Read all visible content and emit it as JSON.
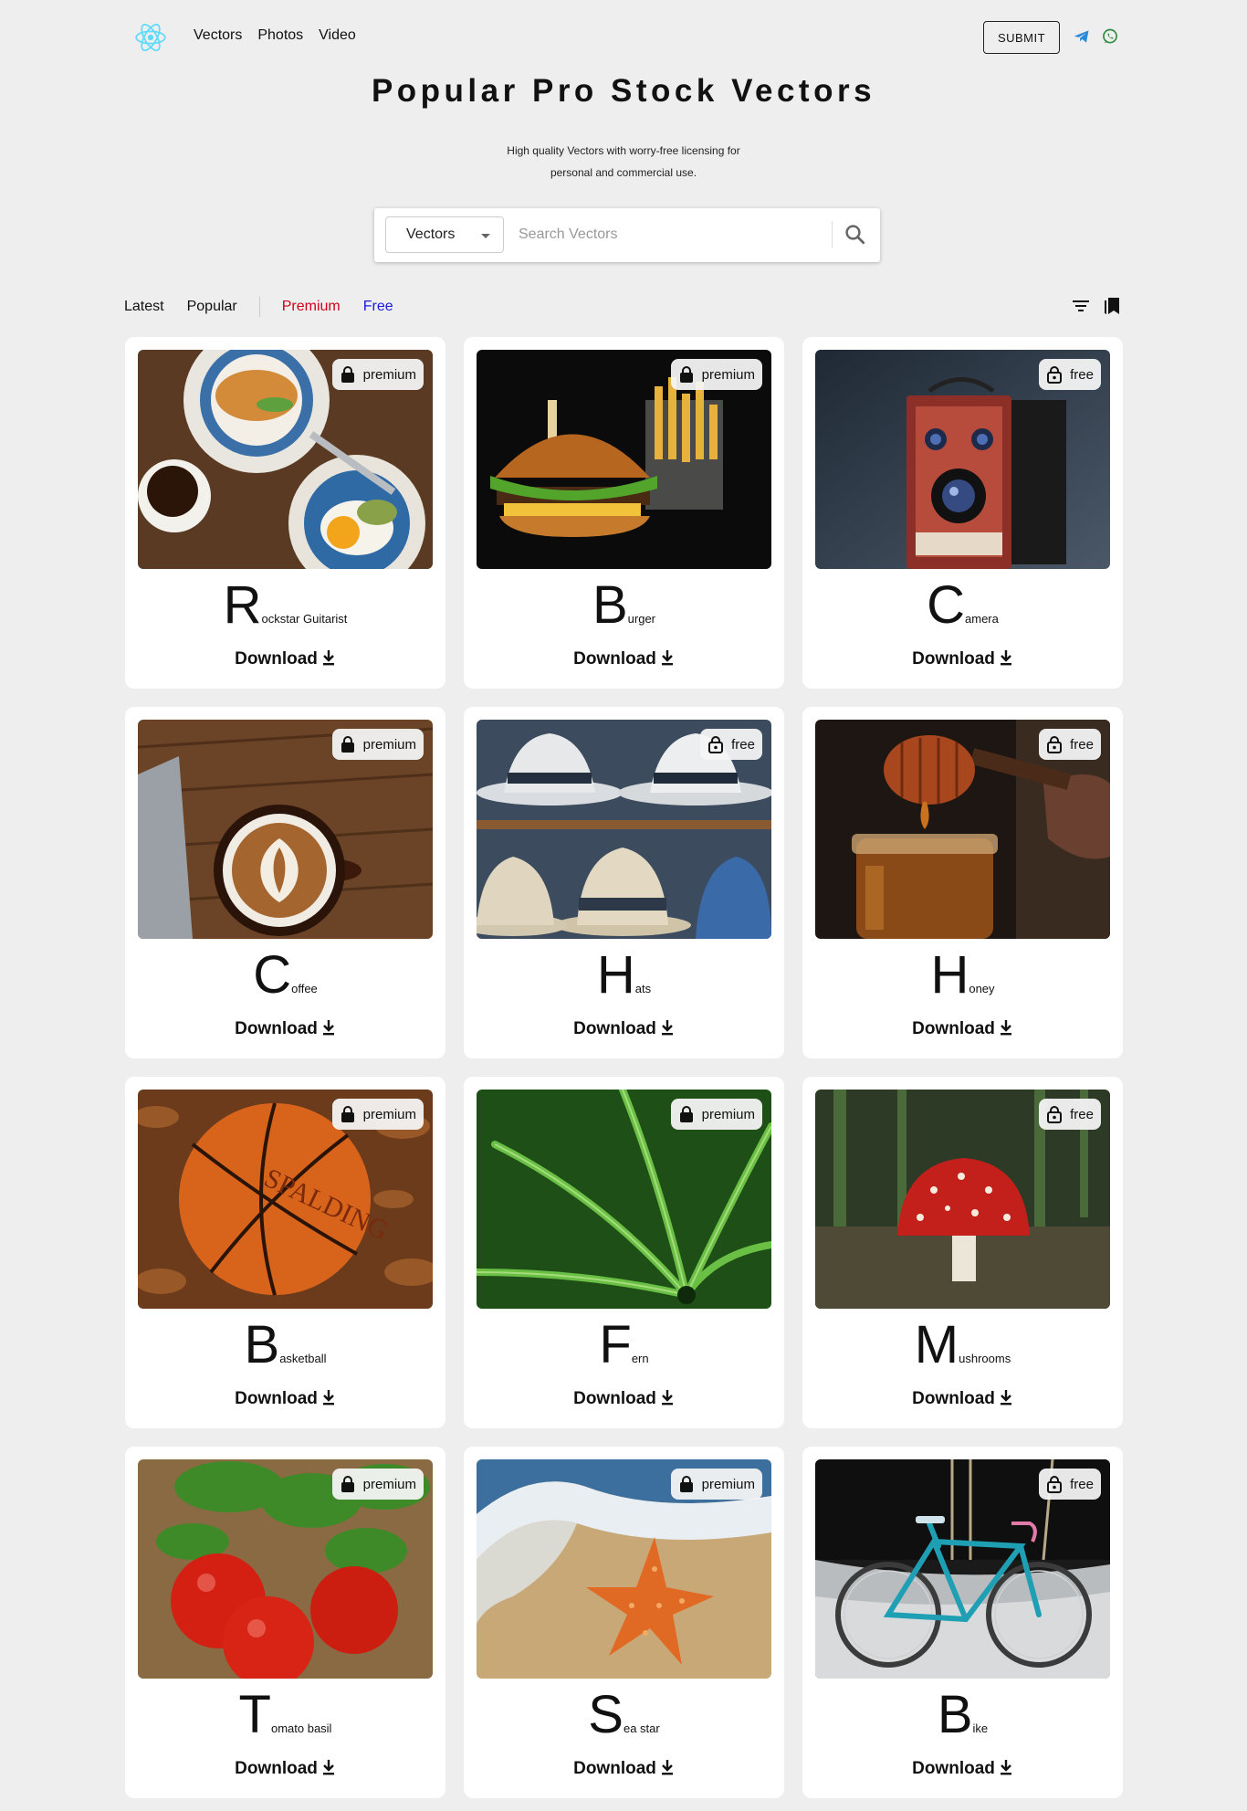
{
  "nav": {
    "links": [
      "Vectors",
      "Photos",
      "Video"
    ],
    "submit_label": "SUBMIT",
    "social": [
      "telegram-icon",
      "whatsapp-icon"
    ]
  },
  "hero": {
    "title": "Popular Pro Stock Vectors",
    "subtitle_line1": "High quality Vectors with worry-free licensing for",
    "subtitle_line2": "personal and commercial use."
  },
  "search": {
    "category_value": "Vectors",
    "placeholder": "Search Vectors"
  },
  "filters": {
    "latest": "Latest",
    "popular": "Popular",
    "premium": "Premium",
    "free": "Free"
  },
  "colors": {
    "premium": "#d0021b",
    "free": "#1a1adb",
    "telegram": "#2a8ad8",
    "whatsapp": "#2e8b3a",
    "logo": "#61dafb"
  },
  "download_label": "Download",
  "cards": [
    {
      "badge": "premium",
      "initial": "R",
      "rest": "ockstar Guitarist",
      "image": "breakfast-table-photo"
    },
    {
      "badge": "premium",
      "initial": "B",
      "rest": "urger",
      "image": "burger-and-fries-photo"
    },
    {
      "badge": "free",
      "initial": "C",
      "rest": "amera",
      "image": "vintage-box-camera-photo"
    },
    {
      "badge": "premium",
      "initial": "C",
      "rest": "offee",
      "image": "latte-art-coffee-photo"
    },
    {
      "badge": "free",
      "initial": "H",
      "rest": "ats",
      "image": "panama-hats-photo"
    },
    {
      "badge": "free",
      "initial": "H",
      "rest": "oney",
      "image": "honey-dipper-jar-photo"
    },
    {
      "badge": "premium",
      "initial": "B",
      "rest": "asketball",
      "image": "basketball-in-leaves-photo"
    },
    {
      "badge": "premium",
      "initial": "F",
      "rest": "ern",
      "image": "fern-leaves-photo"
    },
    {
      "badge": "free",
      "initial": "M",
      "rest": "ushrooms",
      "image": "red-mushroom-photo"
    },
    {
      "badge": "premium",
      "initial": "T",
      "rest": "omato basil",
      "image": "tomato-basil-photo"
    },
    {
      "badge": "premium",
      "initial": "S",
      "rest": "ea star",
      "image": "starfish-beach-photo"
    },
    {
      "badge": "free",
      "initial": "B",
      "rest": "ike",
      "image": "bicycle-photo"
    }
  ]
}
